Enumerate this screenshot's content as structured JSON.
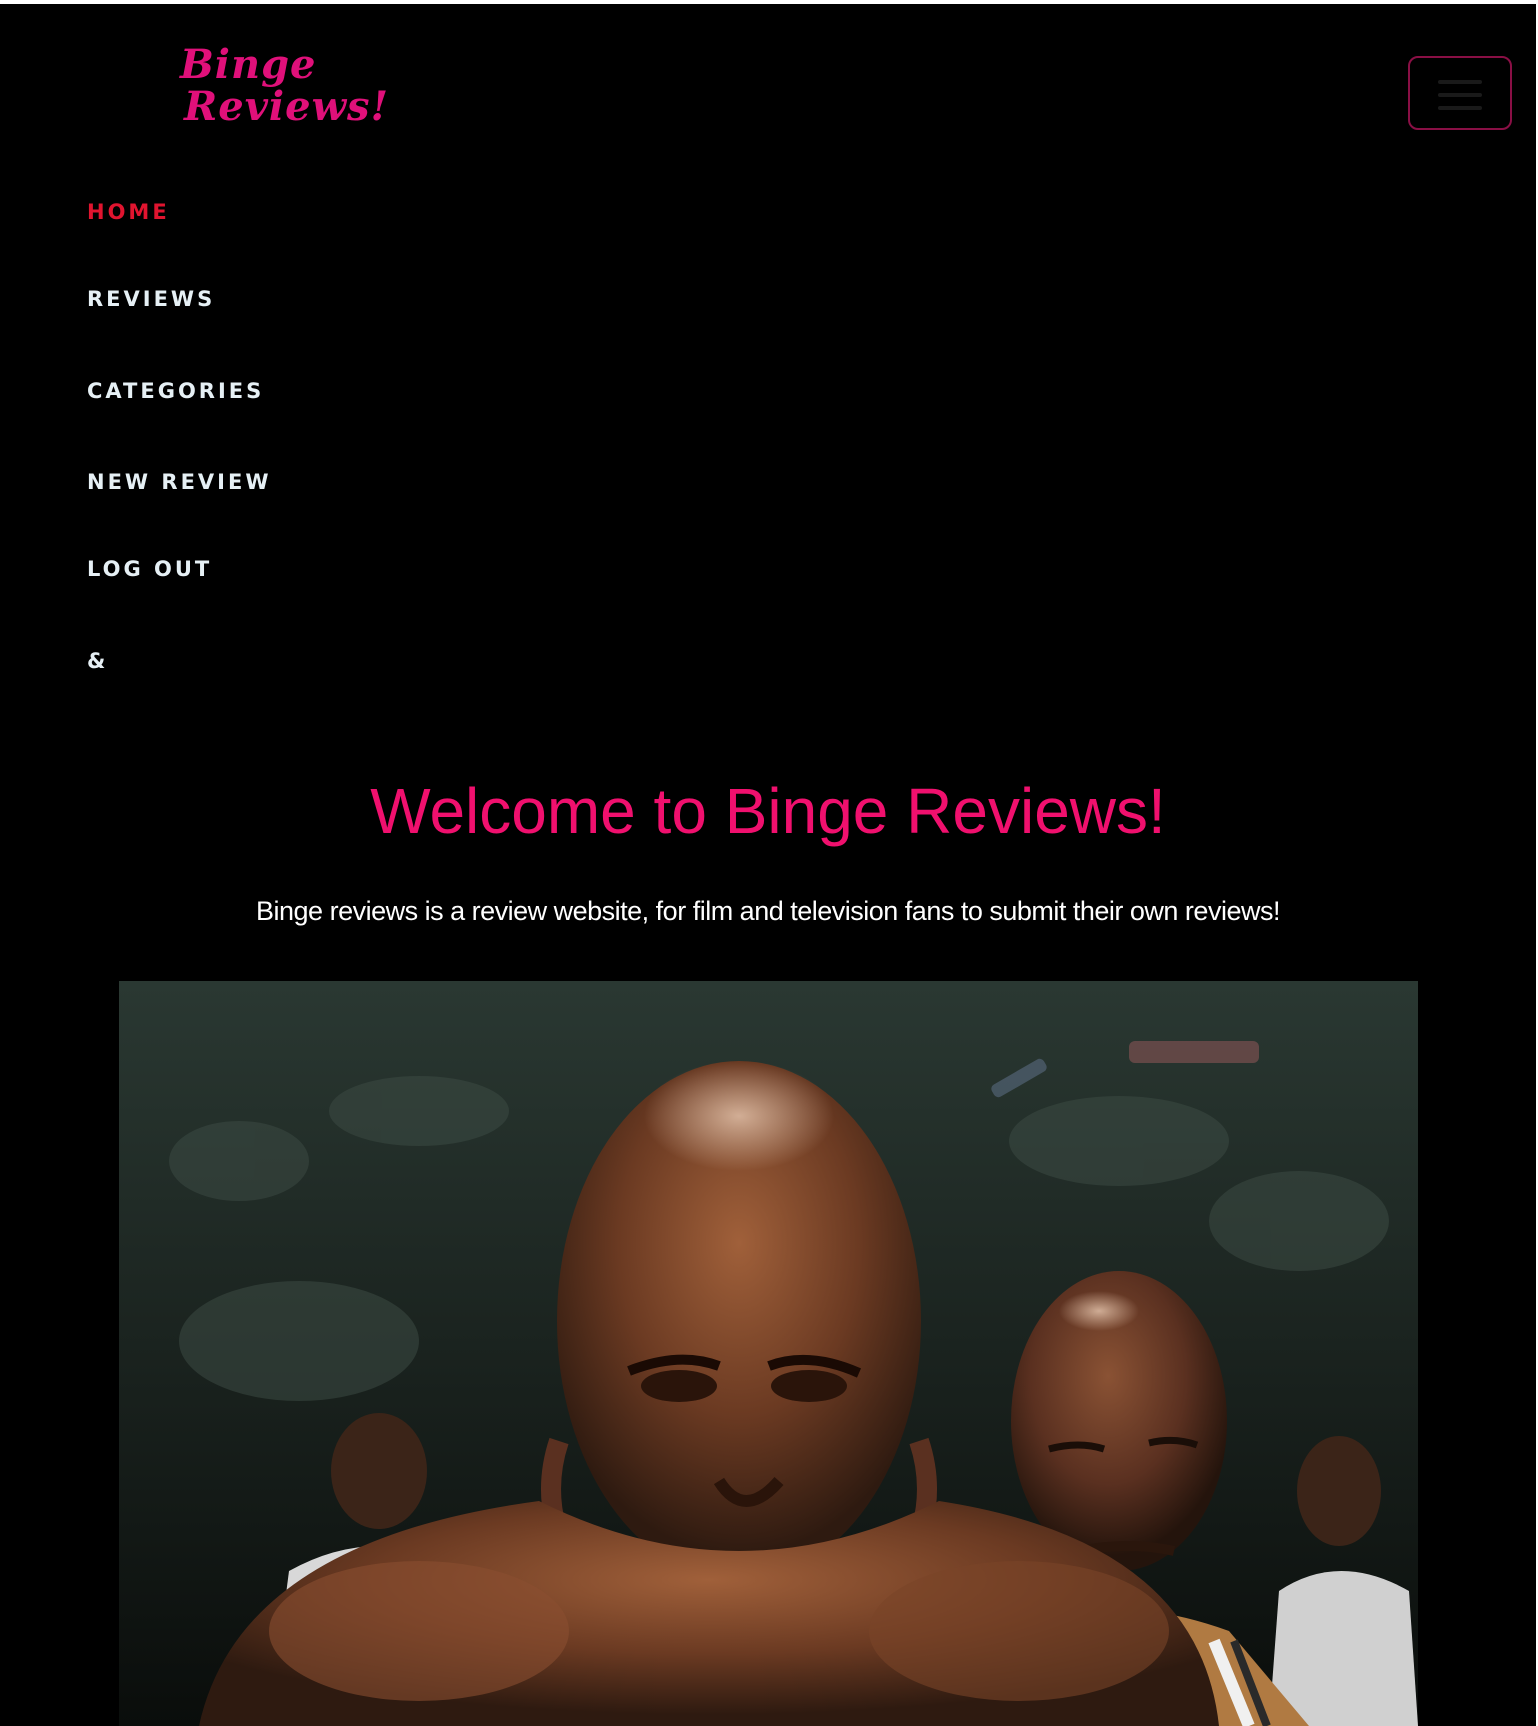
{
  "brand": {
    "logo_line1": "Binge",
    "logo_line2": "Reviews!",
    "color": "#e0107a"
  },
  "navbar": {
    "toggler_icon": "hamburger-icon",
    "items": [
      {
        "label": "HOME",
        "active": true
      },
      {
        "label": "REVIEWS",
        "active": false
      },
      {
        "label": "CATEGORIES",
        "active": false
      },
      {
        "label": "NEW REVIEW",
        "active": false
      },
      {
        "label": "LOG OUT",
        "active": false
      },
      {
        "label": "&",
        "active": false
      }
    ],
    "active_color": "#e0142f"
  },
  "hero": {
    "title": "Welcome to Binge Reviews!",
    "subtitle": "Binge reviews is a review website, for film and television fans to submit their own reviews!",
    "title_color": "#f0106e",
    "image_description_icon": "movie-still-image"
  }
}
